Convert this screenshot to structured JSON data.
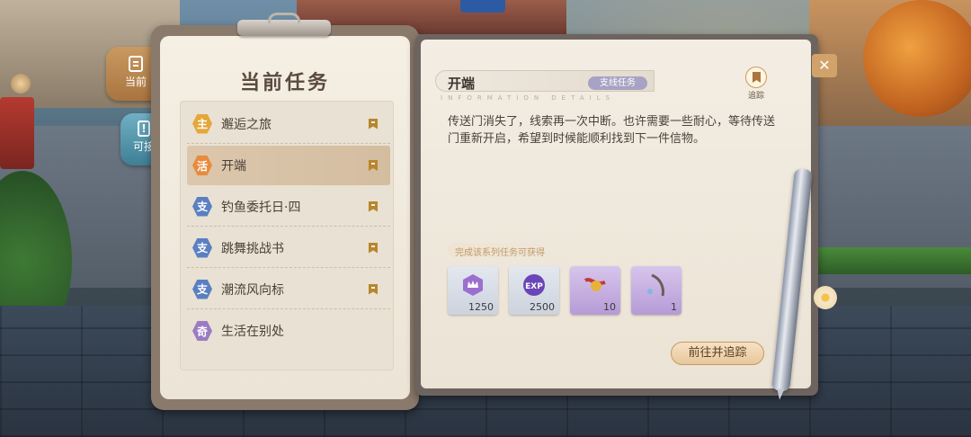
{
  "panel": {
    "title": "当前任务"
  },
  "tabs": [
    {
      "label": "当前",
      "icon": "notebook-icon"
    },
    {
      "label": "可接",
      "icon": "exclamation-icon"
    }
  ],
  "quests": [
    {
      "badge": "主",
      "label": "邂逅之旅",
      "badge_color": "#e4a83a",
      "tracked": true
    },
    {
      "badge": "活",
      "label": "开端",
      "badge_color": "#e98b3e",
      "tracked": true,
      "selected": true
    },
    {
      "badge": "支",
      "label": "钓鱼委托日·四",
      "badge_color": "#5a7fc2",
      "tracked": true
    },
    {
      "badge": "支",
      "label": "跳舞挑战书",
      "badge_color": "#5a7fc2",
      "tracked": true
    },
    {
      "badge": "支",
      "label": "潮流风向标",
      "badge_color": "#5a7fc2",
      "tracked": true
    },
    {
      "badge": "奇",
      "label": "生活在别处",
      "badge_color": "#9b7cc4",
      "tracked": false
    }
  ],
  "detail": {
    "title": "开端",
    "type_tag": "支线任务",
    "subtitle": "INFORMATION DETAILS",
    "track_label": "追踪",
    "description": "传送门消失了，线索再一次中断。也许需要一些耐心，等待传送门重新开启，希望到时候能顺利找到下一件信物。",
    "reward_caption": "完成该系列任务可获得",
    "rewards": [
      {
        "icon": "crown-icon",
        "count": "1250",
        "bg": "grey"
      },
      {
        "icon": "exp-icon",
        "icon_text": "EXP",
        "count": "2500",
        "bg": "grey"
      },
      {
        "icon": "bell-ribbon-icon",
        "count": "10",
        "bg": "purple"
      },
      {
        "icon": "feather-icon",
        "count": "1",
        "bg": "purple"
      }
    ],
    "go_button": "前往并追踪"
  },
  "colors": {
    "accent": "#c99a62",
    "tab_current": "#b07a42",
    "tab_available": "#4f8fa5"
  }
}
